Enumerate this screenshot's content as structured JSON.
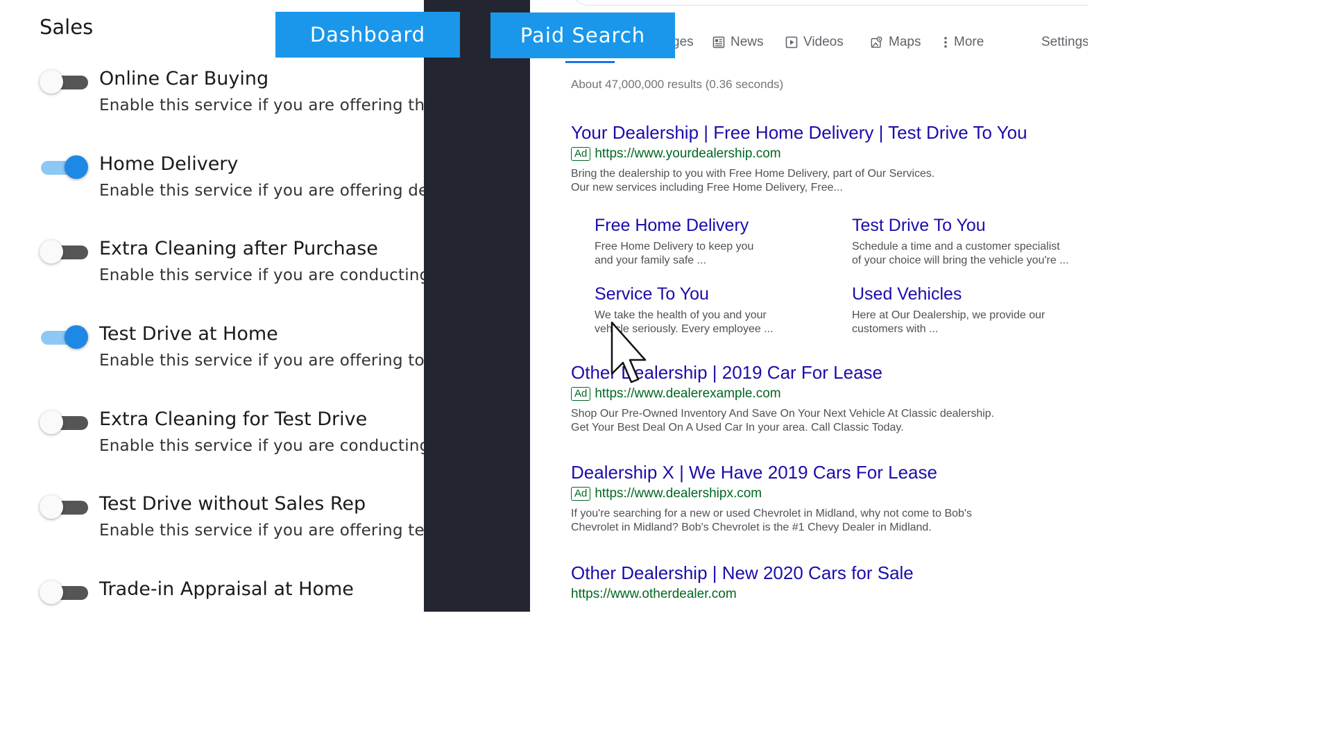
{
  "labels": {
    "dashboard": "Dashboard",
    "paid_search": "Paid Search"
  },
  "sales": {
    "title": "Sales",
    "services": [
      {
        "name": "Online Car Buying",
        "desc": "Enable this service if you are offering the co",
        "enabled": false
      },
      {
        "name": "Home Delivery",
        "desc": "Enable this service if you are offering deliver",
        "enabled": true
      },
      {
        "name": "Extra Cleaning after Purchase",
        "desc": "Enable this service if you are conducting a m",
        "enabled": false
      },
      {
        "name": "Test Drive at Home",
        "desc": "Enable this service if you are offering to brin",
        "enabled": true
      },
      {
        "name": "Extra Cleaning for Test Drive",
        "desc": "Enable this service if you are conducting ext",
        "enabled": false
      },
      {
        "name": "Test Drive without Sales Rep",
        "desc": "Enable this service if you are offering test dr",
        "enabled": false
      },
      {
        "name": "Trade-in Appraisal at Home",
        "desc": "",
        "enabled": false
      }
    ]
  },
  "search": {
    "tabs": [
      {
        "label": "ges",
        "icon": "images-icon"
      },
      {
        "label": "News",
        "icon": "news-icon"
      },
      {
        "label": "Videos",
        "icon": "video-icon"
      },
      {
        "label": "Maps",
        "icon": "maps-icon"
      },
      {
        "label": "More",
        "icon": "more-vertical-icon"
      },
      {
        "label": "Settings",
        "icon": ""
      }
    ],
    "result_stats": "About 47,000,000 results (0.36 seconds)",
    "ad_badge": "Ad",
    "results": [
      {
        "title": "Your Dealership | Free Home Delivery | Test Drive To You",
        "url": "https://www.yourdealership.com",
        "is_ad": true,
        "desc_lines": [
          "Bring the dealership to you with Free Home Delivery, part of Our Services.",
          "Our new services including Free Home Delivery, Free..."
        ],
        "sitelinks": [
          {
            "title": "Free Home Delivery",
            "desc_lines": [
              "Free Home Delivery to keep you",
              "and your family safe ..."
            ]
          },
          {
            "title": "Test Drive To You",
            "desc_lines": [
              "Schedule a time and a customer specialist",
              "of your choice will bring the vehicle you're ..."
            ]
          },
          {
            "title": "Service To You",
            "desc_lines": [
              "We take the health of you and your",
              "vehicle seriously. Every employee ..."
            ]
          },
          {
            "title": "Used Vehicles",
            "desc_lines": [
              "Here at Our Dealership, we provide our",
              "customers with ..."
            ]
          }
        ]
      },
      {
        "title": "Other Dealership | 2019 Car For Lease",
        "url": "https://www.dealerexample.com",
        "is_ad": true,
        "desc_lines": [
          "Shop Our Pre-Owned Inventory And Save On Your Next Vehicle At Classic dealership.",
          "Get Your Best Deal On A Used Car In your area. Call Classic Today."
        ]
      },
      {
        "title": "Dealership X | We Have 2019 Cars For Lease",
        "url": "https://www.dealershipx.com",
        "is_ad": true,
        "desc_lines": [
          "If you're searching for a new or used Chevrolet in Midland, why not come to Bob's",
          "Chevrolet in Midland? Bob's Chevrolet is the #1 Chevy Dealer in Midland."
        ]
      },
      {
        "title": "Other Dealership | New 2020 Cars for Sale",
        "url": "https://www.otherdealer.com",
        "is_ad": false,
        "desc_lines": []
      }
    ]
  },
  "colors": {
    "label_bg": "#1a97ea",
    "divider": "#232630",
    "toggle_on": "#1e88e5",
    "toggle_off": "#555555",
    "link": "#1a0dab",
    "url": "#006621"
  }
}
